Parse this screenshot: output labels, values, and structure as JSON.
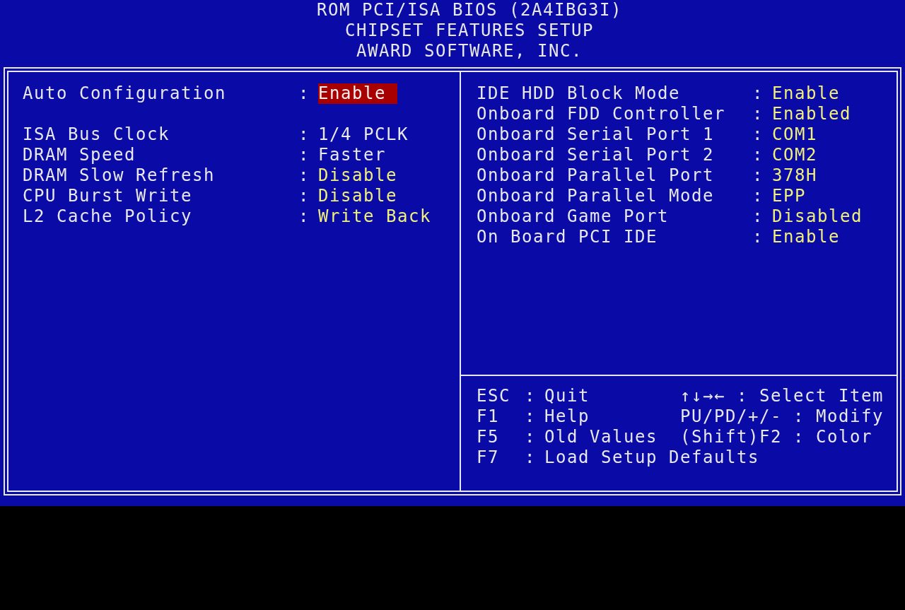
{
  "header": [
    "ROM PCI/ISA BIOS (2A4IBG3I)",
    "CHIPSET FEATURES SETUP",
    "AWARD SOFTWARE, INC."
  ],
  "separator": ":",
  "left_groups": [
    [
      {
        "label": "Auto Configuration",
        "value": "Enable",
        "selected": true,
        "locked": false
      }
    ],
    [
      {
        "label": "ISA Bus Clock",
        "value": "1/4 PCLK",
        "selected": false,
        "locked": true
      },
      {
        "label": "DRAM Speed",
        "value": "Faster",
        "selected": false,
        "locked": true
      },
      {
        "label": "DRAM Slow Refresh",
        "value": "Disable",
        "selected": false,
        "locked": false
      },
      {
        "label": "CPU Burst Write",
        "value": "Disable",
        "selected": false,
        "locked": false
      },
      {
        "label": "L2 Cache Policy",
        "value": "Write Back",
        "selected": false,
        "locked": false
      }
    ]
  ],
  "right_items": [
    {
      "label": "IDE HDD Block Mode",
      "value": "Enable",
      "selected": false,
      "locked": false
    },
    {
      "label": "Onboard FDD Controller",
      "value": "Enabled",
      "selected": false,
      "locked": false
    },
    {
      "label": "Onboard Serial Port 1",
      "value": "COM1",
      "selected": false,
      "locked": false
    },
    {
      "label": "Onboard Serial Port 2",
      "value": "COM2",
      "selected": false,
      "locked": false
    },
    {
      "label": "Onboard Parallel Port",
      "value": "378H",
      "selected": false,
      "locked": false
    },
    {
      "label": "Onboard Parallel Mode",
      "value": "EPP",
      "selected": false,
      "locked": false
    },
    {
      "label": "Onboard Game Port",
      "value": "Disabled",
      "selected": false,
      "locked": false
    },
    {
      "label": "On Board PCI IDE",
      "value": "Enable",
      "selected": false,
      "locked": false
    }
  ],
  "help_left": [
    {
      "key": "ESC",
      "action": "Quit"
    },
    {
      "key": "F1",
      "action": "Help"
    },
    {
      "key": "F5",
      "action": "Old Values"
    },
    {
      "key": "F7",
      "action": "Load Setup Defaults"
    }
  ],
  "help_right": [
    {
      "key": "↑↓→←",
      "action": "Select Item"
    },
    {
      "key": "PU/PD/+/-",
      "action": "Modify"
    },
    {
      "key": "(Shift)F2",
      "action": "Color"
    }
  ]
}
